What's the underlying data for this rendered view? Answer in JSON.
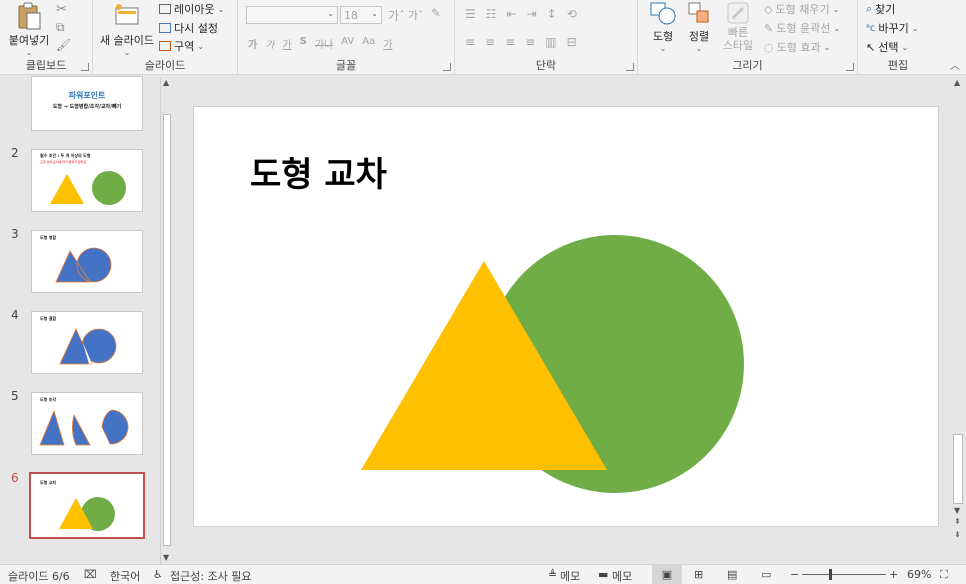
{
  "ribbon": {
    "clipboard": {
      "label": "클립보드",
      "paste": "붙여넣기"
    },
    "slides": {
      "label": "슬라이드",
      "new_slide": "새 슬라이드",
      "layout": "레이아웃",
      "reset": "다시 설정",
      "section": "구역"
    },
    "font": {
      "label": "글꼴",
      "font_size": "18"
    },
    "paragraph": {
      "label": "단락"
    },
    "drawing": {
      "label": "그리기",
      "shapes": "도형",
      "arrange": "정렬",
      "quick_styles": "빠른\n스타일",
      "fill": "도형 채우기",
      "outline": "도형 윤곽선",
      "effects": "도형 효과"
    },
    "editing": {
      "label": "편집",
      "find": "찾기",
      "replace": "바꾸기",
      "select": "선택"
    }
  },
  "thumbnails": [
    {
      "num": "",
      "title": "파워포인트",
      "subtitle": "도형 → 도형병합/조각/교차/빼기"
    },
    {
      "num": "2",
      "title": "필수 조건 : 두 개 이상의 도형",
      "subtitle": "도형 선택 순서에 따라 결과가 달라짐"
    },
    {
      "num": "3",
      "title": "도형 병합"
    },
    {
      "num": "4",
      "title": "도형 결합"
    },
    {
      "num": "5",
      "title": "도형 조각"
    },
    {
      "num": "6",
      "title": "도형 교차"
    }
  ],
  "slide": {
    "title": "도형 교차"
  },
  "colors": {
    "triangle": "#ffc000",
    "circle": "#70ad47",
    "merge_blue": "#4472c4",
    "selected_border": "#c0504d"
  },
  "status": {
    "slide_count": "슬라이드 6/6",
    "language": "한국어",
    "accessibility": "접근성: 조사 필요",
    "notes": "메모",
    "comments": "메모",
    "zoom": "69%"
  }
}
